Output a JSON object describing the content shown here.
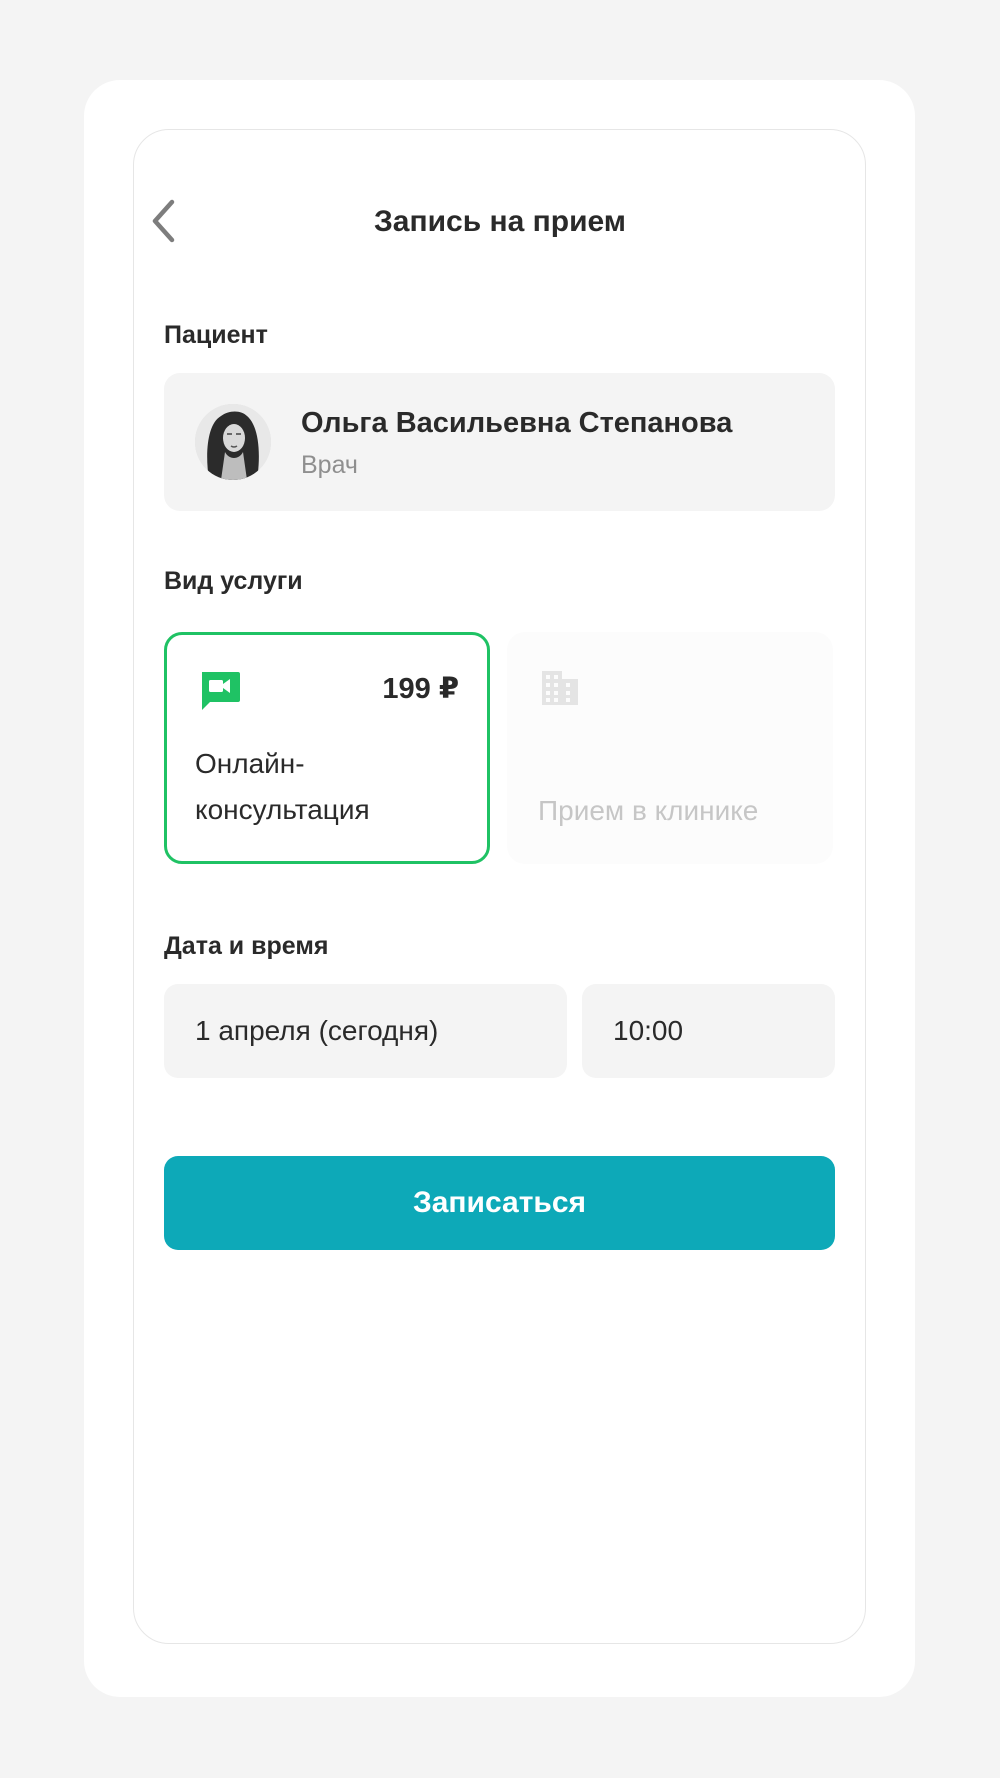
{
  "header": {
    "title": "Запись на прием",
    "back_icon": "chevron-left-icon"
  },
  "patient": {
    "section_label": "Пациент",
    "name": "Ольга Васильевна Степанова",
    "role": "Врач"
  },
  "service": {
    "section_label": "Вид услуги",
    "options": [
      {
        "icon": "video-chat-icon",
        "price": "199 ₽",
        "label": "Онлайн-консультация",
        "selected": true
      },
      {
        "icon": "building-icon",
        "price": "",
        "label": "Прием в клинике",
        "selected": false
      }
    ]
  },
  "datetime": {
    "section_label": "Дата и время",
    "date": "1 апреля (сегодня)",
    "time": "10:00"
  },
  "submit_label": "Записаться",
  "colors": {
    "accent": "#0da9b8",
    "selected_border": "#1fc264",
    "icon_green": "#1fc264"
  }
}
